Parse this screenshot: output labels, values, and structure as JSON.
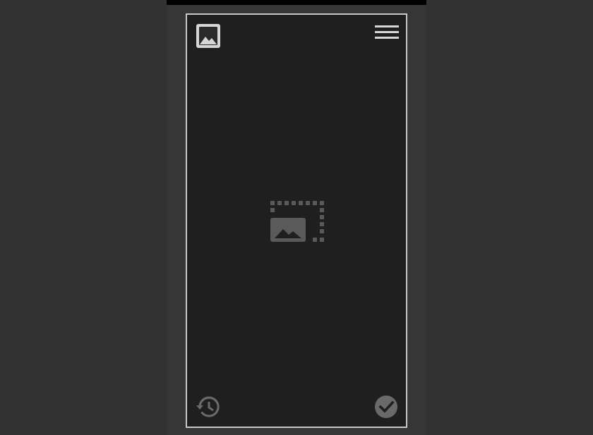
{
  "app": {
    "background_color": "#323232",
    "canvas_color": "#1f1f1f",
    "border_color": "#c8c8c8"
  },
  "toolbar": {
    "gallery_icon": "image-icon",
    "menu_icon": "hamburger-menu-icon"
  },
  "canvas": {
    "placeholder_icon": "select-image-area-icon",
    "icon_color": "#5a5a5a"
  },
  "bottom_bar": {
    "history_icon": "history-icon",
    "confirm_icon": "check-circle-icon",
    "icon_color": "#6a6a6a"
  }
}
